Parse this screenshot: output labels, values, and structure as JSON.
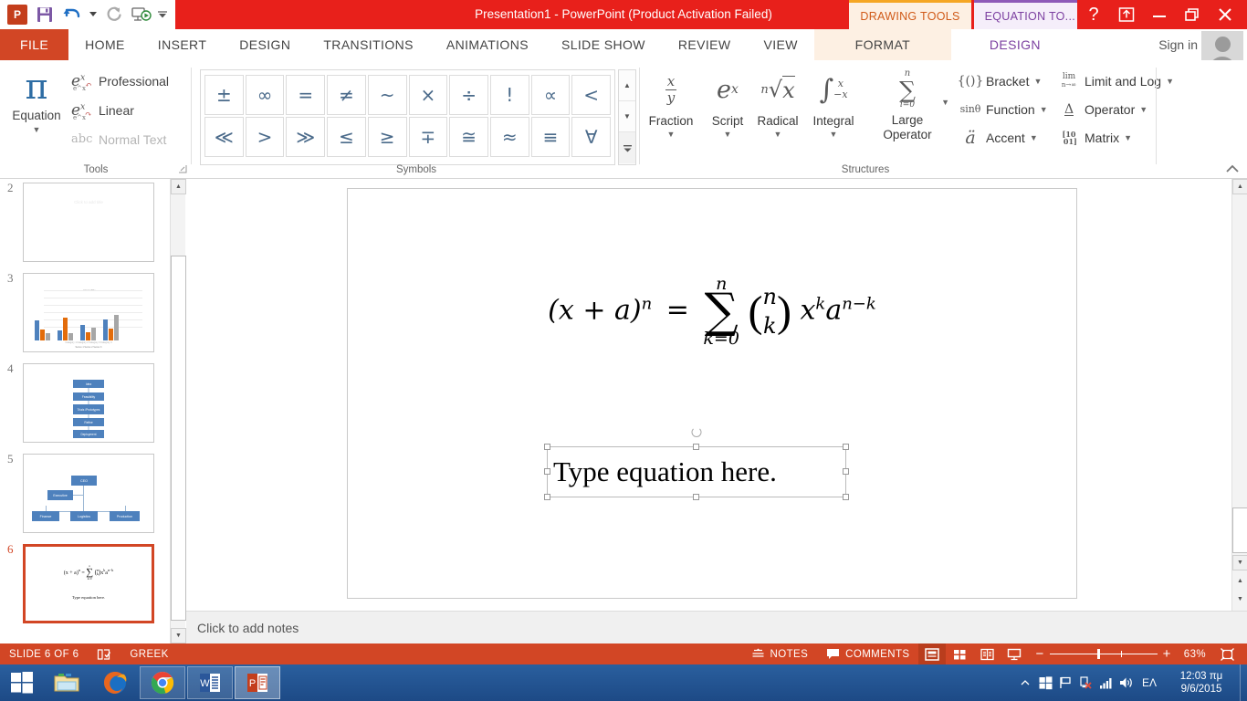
{
  "window": {
    "title": "Presentation1  -  PowerPoint (Product Activation Failed)",
    "quick_access": [
      {
        "name": "ppt-logo",
        "label": "P"
      },
      {
        "name": "save-icon",
        "label": "Save"
      },
      {
        "name": "undo-icon",
        "label": "Undo"
      },
      {
        "name": "redo-icon",
        "label": "Repeat"
      },
      {
        "name": "start-slideshow-icon",
        "label": "Start From Beginning"
      },
      {
        "name": "customize-qat-icon",
        "label": "Customize Quick Access Toolbar"
      }
    ],
    "context_tabs": [
      {
        "label": "DRAWING TOOLS",
        "color": "#d05a18"
      },
      {
        "label": "EQUATION TO...",
        "color": "#7b3fa0"
      }
    ],
    "window_buttons": [
      "help",
      "ribbon-display-options",
      "minimize",
      "restore",
      "close"
    ]
  },
  "ribbon": {
    "tabs": [
      {
        "label": "FILE",
        "type": "file"
      },
      {
        "label": "HOME",
        "type": "normal"
      },
      {
        "label": "INSERT",
        "type": "normal"
      },
      {
        "label": "DESIGN",
        "type": "normal"
      },
      {
        "label": "TRANSITIONS",
        "type": "normal"
      },
      {
        "label": "ANIMATIONS",
        "type": "normal"
      },
      {
        "label": "SLIDE SHOW",
        "type": "normal"
      },
      {
        "label": "REVIEW",
        "type": "normal"
      },
      {
        "label": "VIEW",
        "type": "normal"
      },
      {
        "label": "FORMAT",
        "type": "context-format"
      },
      {
        "label": "DESIGN",
        "type": "context-active"
      }
    ],
    "sign_in": "Sign in",
    "groups": {
      "tools": {
        "label": "Tools",
        "equation_button": {
          "label": "Equation",
          "glyph": "π"
        },
        "items": [
          {
            "label": "Professional",
            "icon": "professional-icon",
            "disabled": false
          },
          {
            "label": "Linear",
            "icon": "linear-icon",
            "disabled": false
          },
          {
            "label": "Normal Text",
            "icon": "abc-icon",
            "disabled": true
          }
        ]
      },
      "symbols": {
        "label": "Symbols",
        "rows": [
          [
            "±",
            "∞",
            "=",
            "≠",
            "~",
            "×",
            "÷",
            "!",
            "∝",
            "<"
          ],
          [
            "≪",
            ">",
            "≫",
            "≤",
            "≥",
            "∓",
            "≅",
            "≈",
            "≡",
            "∀"
          ]
        ],
        "scroll_buttons": [
          "scroll-up-icon",
          "scroll-down-icon",
          "more-icon"
        ]
      },
      "structures": {
        "label": "Structures",
        "big_buttons": [
          {
            "label": "Fraction",
            "glyph": "x/y",
            "icon": "fraction-icon"
          },
          {
            "label": "Script",
            "glyph": "e^x",
            "icon": "script-icon"
          },
          {
            "label": "Radical",
            "glyph": "n√x",
            "icon": "radical-icon"
          },
          {
            "label": "Integral",
            "glyph": "∫",
            "icon": "integral-icon"
          },
          {
            "label": "Large Operator",
            "glyph": "∑",
            "icon": "large-operator-icon"
          }
        ],
        "small_buttons": [
          {
            "label": "Bracket",
            "glyph": "{()}",
            "icon": "bracket-icon"
          },
          {
            "label": "Limit and Log",
            "glyph": "lim",
            "icon": "limit-log-icon"
          },
          {
            "label": "Function",
            "glyph": "sinθ",
            "icon": "function-icon"
          },
          {
            "label": "Operator",
            "glyph": "∆",
            "icon": "operator-icon"
          },
          {
            "label": "Accent",
            "glyph": "ä",
            "icon": "accent-icon"
          },
          {
            "label": "Matrix",
            "glyph": "10 01",
            "icon": "matrix-icon"
          }
        ]
      }
    },
    "collapse_label": "Collapse the Ribbon"
  },
  "slide_panel": {
    "thumbnails": [
      {
        "number": "2",
        "kind": "title-placeholder",
        "text": "Click to add title",
        "selected": false
      },
      {
        "number": "3",
        "kind": "chart",
        "title": "Chart Title",
        "selected": false
      },
      {
        "number": "4",
        "kind": "process-flow",
        "selected": false
      },
      {
        "number": "5",
        "kind": "org-chart",
        "selected": false
      },
      {
        "number": "6",
        "kind": "equation",
        "selected": true
      }
    ],
    "chart_thumb": {
      "title": "Chart Title",
      "legend": "Series 1   Series 2   Series 3",
      "axis": "Category 1   Category 2   Category 3   Category 4"
    },
    "flow_boxes": [
      "Idea",
      "Feasibility",
      "Trials /Prototypes",
      "Refine",
      "Deployment"
    ],
    "org_boxes": {
      "top": "CEO",
      "mid": "Executive",
      "bottom": [
        "Finance",
        "Logistics",
        "Production"
      ]
    }
  },
  "slide": {
    "equation": {
      "lhs": "(x + a)",
      "lhs_exp": "n",
      "eq": "=",
      "sum_upper": "n",
      "sum_lower": "k=0",
      "binom_top": "n",
      "binom_bottom": "k",
      "term1": "x",
      "term1_exp": "k",
      "term2": "a",
      "term2_exp": "n−k",
      "plain": "(x + a)^n = ∑(k=0..n) C(n,k) x^k a^(n−k)"
    },
    "textbox": {
      "text": "Type equation here.",
      "selected": true
    }
  },
  "notes": {
    "placeholder": "Click to add notes"
  },
  "status_bar": {
    "slide_indicator": "SLIDE 6 OF 6",
    "language": "GREEK",
    "notes_button": "NOTES",
    "comments_button": "COMMENTS",
    "views": [
      "normal-view-icon",
      "slide-sorter-icon",
      "reading-view-icon",
      "slideshow-icon"
    ],
    "zoom_level": "63%",
    "zoom_out": "−",
    "zoom_in": "+",
    "fit_button": "fit-slide-to-window-icon"
  },
  "taskbar": {
    "start": "start-button",
    "apps": [
      {
        "name": "file-explorer-icon",
        "state": "pinned"
      },
      {
        "name": "firefox-icon",
        "state": "pinned"
      },
      {
        "name": "chrome-icon",
        "state": "open"
      },
      {
        "name": "word-icon",
        "state": "open"
      },
      {
        "name": "powerpoint-icon",
        "state": "active"
      }
    ],
    "tray": {
      "icons": [
        "show-hidden-icons",
        "windows-icon",
        "action-flag-icon",
        "network-problem-icon",
        "signal-bars-icon",
        "volume-icon"
      ],
      "language": "ΕΛ",
      "time": "12:03 πμ",
      "date": "9/6/2015"
    }
  },
  "colors": {
    "title_red": "#e8201b",
    "file_orange": "#d24625",
    "equation_purple": "#7b3fa0",
    "drawing_orange": "#d05a18",
    "taskbar_blue": "#1d4a86",
    "accent_blue": "#4e81bd"
  }
}
